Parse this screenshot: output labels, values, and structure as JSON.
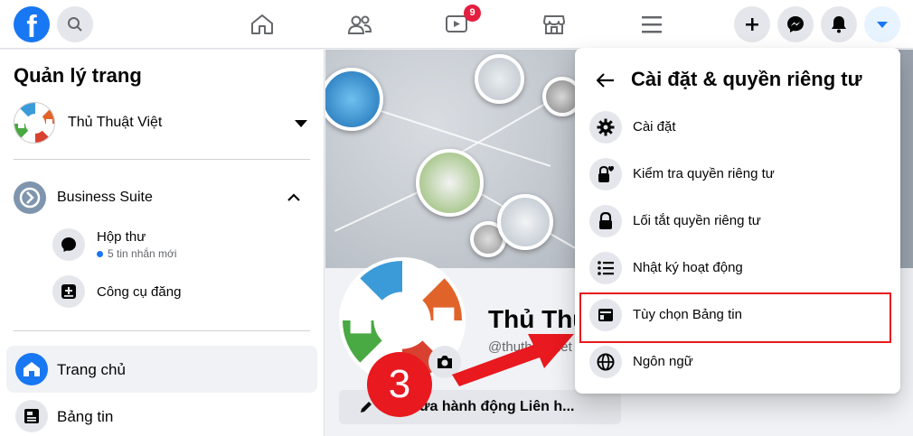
{
  "topbar": {
    "logo_letter": "f",
    "video_badge": "9",
    "icons": [
      "search-icon",
      "home-icon",
      "friends-icon",
      "watch-icon",
      "marketplace-icon",
      "menu-icon",
      "plus-icon",
      "messenger-icon",
      "notifications-icon",
      "account-caret-icon"
    ],
    "accent": "#1877f2"
  },
  "sidebar": {
    "title": "Quản lý trang",
    "page_name": "Thủ Thuật Việt",
    "business_suite": "Business Suite",
    "inbox_label": "Hộp thư",
    "inbox_meta": "5 tin nhắn mới",
    "publish_label": "Công cụ đăng",
    "home_label": "Trang chủ",
    "feed_label": "Bảng tin"
  },
  "main": {
    "page_name": "Thủ Thuật Việt",
    "handle": "@thuthuatviet",
    "edit_button": "sửa hành động Liên h..."
  },
  "annotation": {
    "step_number": "3",
    "color": "#e8191f"
  },
  "panel": {
    "title": "Cài đặt & quyền riêng tư",
    "items": [
      {
        "label": "Cài đặt",
        "icon": "gear-icon"
      },
      {
        "label": "Kiểm tra quyền riêng tư",
        "icon": "lock-heart-icon"
      },
      {
        "label": "Lối tắt quyền riêng tư",
        "icon": "lock-icon"
      },
      {
        "label": "Nhật ký hoạt động",
        "icon": "list-icon"
      },
      {
        "label": "Tùy chọn Bảng tin",
        "icon": "feed-icon"
      },
      {
        "label": "Ngôn ngữ",
        "icon": "globe-icon"
      }
    ]
  }
}
